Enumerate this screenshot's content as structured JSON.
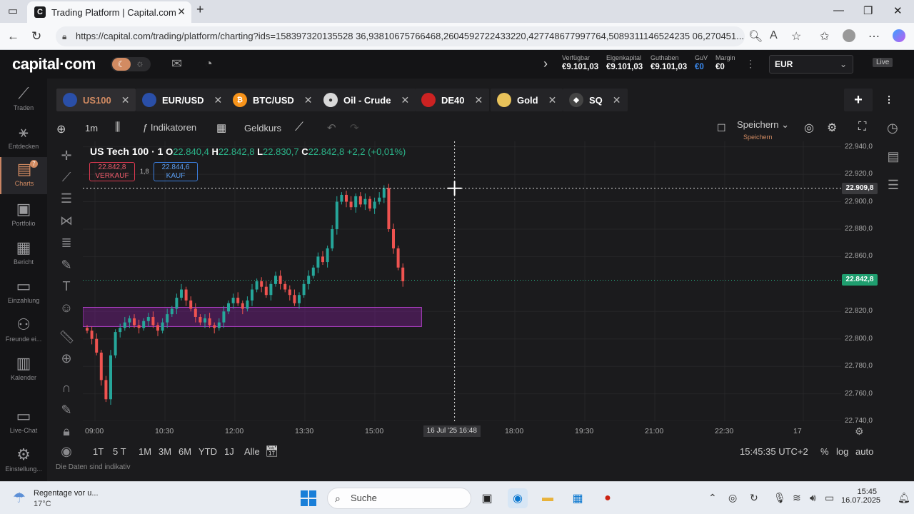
{
  "browser": {
    "tab_title": "Trading Platform | Capital.com",
    "url": "https://capital.com/trading/platform/charting?ids=158397320135528 36,93810675766468,2604592722433220,427748677997764,5089311146524235 06,270451...",
    "favicon_letter": "C"
  },
  "app": {
    "logo": "capital·com",
    "account": {
      "verfuegbar_label": "Verfügbar",
      "verfuegbar": "€9.101,03",
      "eigenkapital_label": "Eigenkapital",
      "eigenkapital": "€9.101,03",
      "guthaben_label": "Guthaben",
      "guthaben": "€9.101,03",
      "guv_label": "GuV",
      "guv": "€0",
      "margin_label": "Margin",
      "margin": "€0"
    },
    "currency": "EUR",
    "live": "Live"
  },
  "sidebar": [
    {
      "label": "Traden",
      "icon": "trend-icon"
    },
    {
      "label": "Entdecken",
      "icon": "network-icon"
    },
    {
      "label": "Charts",
      "icon": "charts-icon"
    },
    {
      "label": "Portfolio",
      "icon": "briefcase-icon"
    },
    {
      "label": "Bericht",
      "icon": "report-icon"
    },
    {
      "label": "Einzahlung",
      "icon": "wallet-icon"
    },
    {
      "label": "Freunde ei...",
      "icon": "friends-icon"
    },
    {
      "label": "Kalender",
      "icon": "calendar-icon"
    },
    {
      "label": "Live-Chat",
      "icon": "chat-icon"
    },
    {
      "label": "Einstellung...",
      "icon": "gear-icon"
    }
  ],
  "charts_badge": "7",
  "instruments": [
    {
      "label": "US100",
      "color": "#2a4fa8"
    },
    {
      "label": "EUR/USD",
      "color": "#2a4fa8"
    },
    {
      "label": "BTC/USD",
      "color": "#f7931a"
    },
    {
      "label": "Oil - Crude",
      "color": "#d8d8d8"
    },
    {
      "label": "DE40",
      "color": "#c22"
    },
    {
      "label": "Gold",
      "color": "#e8c25a"
    },
    {
      "label": "SQ",
      "color": "#444"
    }
  ],
  "toolbar": {
    "interval": "1m",
    "indicators": "Indikatoren",
    "price_type": "Geldkurs",
    "save": "Speichern",
    "save_sub": "Speichern"
  },
  "legend": {
    "name": "US Tech 100 · 1",
    "o_key": "O",
    "o": "22.840,4",
    "h_key": "H",
    "h": "22.842,8",
    "l_key": "L",
    "l": "22.830,7",
    "c_key": "C",
    "c": "22.842,8",
    "change": "+2,2 (+0,01%)",
    "sell_price": "22.842,8",
    "sell_label": "VERKAUF",
    "spread": "1,8",
    "buy_price": "22.844,6",
    "buy_label": "KAUF"
  },
  "chart_data": {
    "type": "candlestick",
    "y_ticks": [
      "22.940,0",
      "22.920,0",
      "22.900,0",
      "22.880,0",
      "22.860,0",
      "22.820,0",
      "22.800,0",
      "22.780,0",
      "22.760,0",
      "22.740,0"
    ],
    "crosshair_price": "22.909,8",
    "last_price": "22.842,8",
    "x_ticks": [
      "09:00",
      "10:30",
      "12:00",
      "13:30",
      "15:00",
      "18:00",
      "19:30",
      "21:00",
      "22:30",
      "17"
    ],
    "crosshair_time": "16 Jul '25   16:48",
    "ylim": [
      22740,
      22944
    ],
    "zone": {
      "from_time": "09:00",
      "to_time": "16:00",
      "low": 22809,
      "high": 22823,
      "color": "#9b2fae"
    },
    "series_close": [
      22806,
      22800,
      22790,
      22770,
      22756,
      22788,
      22805,
      22808,
      22812,
      22815,
      22810,
      22808,
      22813,
      22816,
      22810,
      22806,
      22812,
      22818,
      22822,
      22830,
      22836,
      22828,
      22822,
      22816,
      22812,
      22815,
      22810,
      22808,
      22812,
      22820,
      22826,
      22830,
      22826,
      22822,
      22828,
      22836,
      22842,
      22838,
      22832,
      22840,
      22846,
      22840,
      22836,
      22832,
      22826,
      22832,
      22840,
      22846,
      22852,
      22860,
      22856,
      22866,
      22880,
      22900,
      22905,
      22900,
      22896,
      22904,
      22898,
      22902,
      22895,
      22900,
      22903,
      22910,
      22880,
      22866,
      22852,
      22842
    ]
  },
  "bottom": {
    "ranges": [
      "1T",
      "5 T",
      "1M",
      "3M",
      "6M",
      "YTD",
      "1J",
      "Alle"
    ],
    "time": "15:45:35 UTC+2",
    "percent": "%",
    "log": "log",
    "auto": "auto",
    "disclaimer": "Die Daten sind indikativ"
  },
  "taskbar": {
    "weather_line1": "Regentage vor u...",
    "weather_line2": "17°C",
    "search": "Suche",
    "time": "15:45",
    "date": "16.07.2025"
  }
}
